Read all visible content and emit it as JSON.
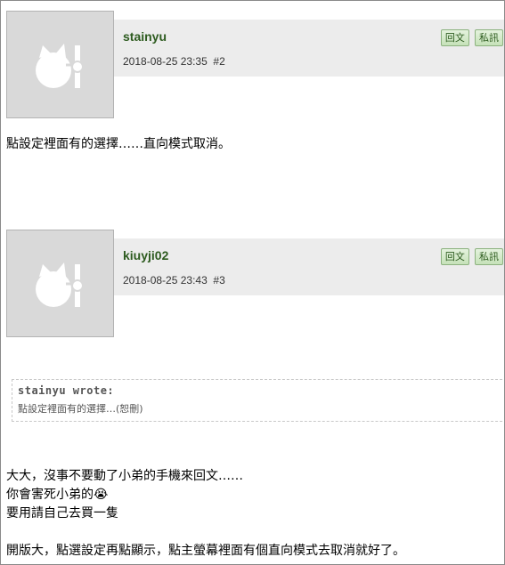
{
  "posts": [
    {
      "username": "stainyu",
      "datetime": "2018-08-25 23:35",
      "post_number": "#2",
      "buttons": {
        "reply": "回文",
        "pm": "私訊"
      },
      "body": [
        "點設定裡面有的選擇……直向模式取消。"
      ]
    },
    {
      "username": "kiuyji02",
      "datetime": "2018-08-25 23:43",
      "post_number": "#3",
      "buttons": {
        "reply": "回文",
        "pm": "私訊"
      },
      "quote": {
        "author": "stainyu wrote:",
        "text": "點設定裡面有的選擇…(恕刪)"
      },
      "body": [
        "大大，沒事不要動了小弟的手機來回文……",
        "你會害死小弟的😭",
        "要用請自己去買一隻",
        "開版大，點選設定再點顯示，點主螢幕裡面有個直向模式去取消就好了。"
      ]
    }
  ],
  "colors": {
    "username": "#2d5b1f",
    "meta_bar": "#ececec",
    "avatar_bg": "#d9d9d9",
    "button_bg": "#c6e2b9"
  },
  "icons": {
    "avatar": "default-avatar-icon"
  }
}
